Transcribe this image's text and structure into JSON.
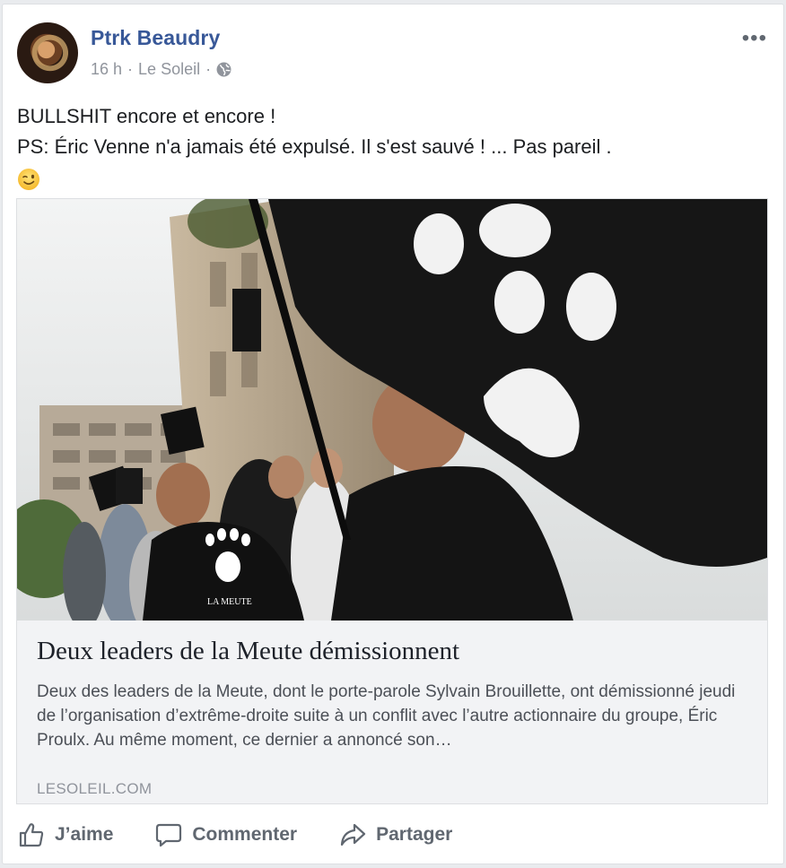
{
  "post": {
    "author": "Ptrk Beaudry",
    "time": "16 h",
    "separator1": "·",
    "source": "Le Soleil",
    "separator2": "·",
    "audience_icon": "globe-icon",
    "more_label": "•••",
    "text_line1": "BULLSHIT encore et encore !",
    "text_line2": "PS: Éric Venne n'a jamais été expulsé. Il s'est sauvé ! ... Pas pareil .",
    "emoji": "wink-emoji"
  },
  "link_preview": {
    "title": "Deux leaders de la Meute démissionnent",
    "description": "Deux des leaders de la Meute, dont le porte-parole Sylvain Brouillette, ont démissionné jeudi de l’organisation d’extrême-droite suite à un conflit avec l’autre actionnaire du groupe, Éric Proulx. Au même moment, ce dernier a annoncé son…",
    "domain": "LESOLEIL.COM",
    "image_shirt_text": "LA MEUTE"
  },
  "actions": {
    "like_label": "J’aime",
    "comment_label": "Commenter",
    "share_label": "Partager"
  },
  "colors": {
    "author_link": "#385898",
    "meta_text": "#90949c",
    "action_text": "#606770"
  }
}
